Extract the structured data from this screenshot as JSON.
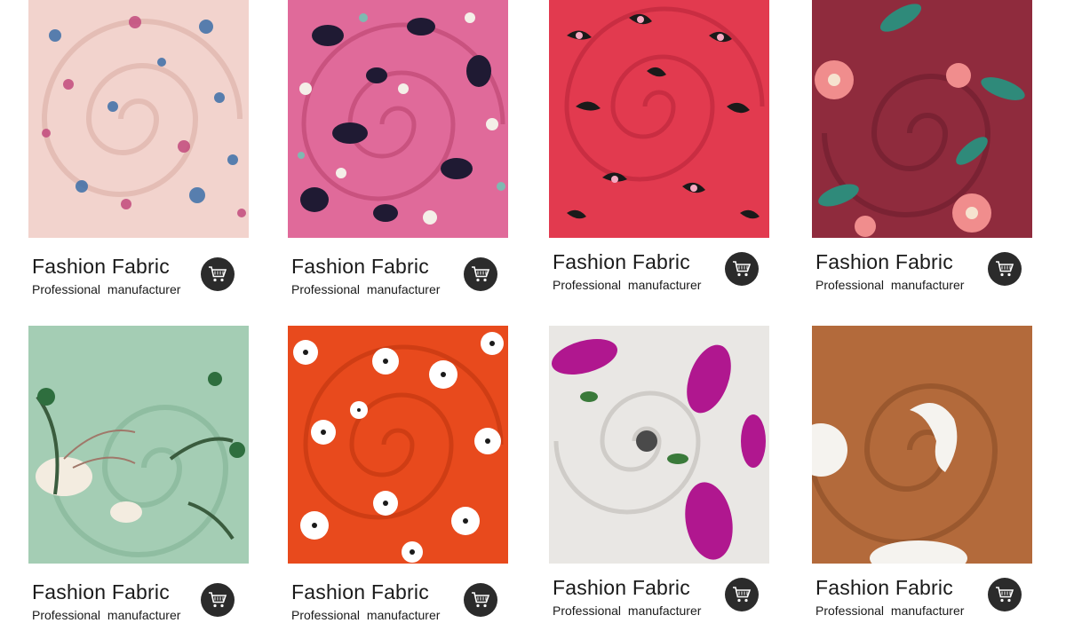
{
  "products": [
    {
      "title": "Fashion Fabric",
      "subtitle": "Professional  manufacturer",
      "swatch": "pink-floral-bullet-knit",
      "colors": {
        "base": "#f2d3cd",
        "accent1": "#3c6fa8",
        "accent2": "#c24a7c"
      }
    },
    {
      "title": "Fashion Fabric",
      "subtitle": "Professional  manufacturer",
      "swatch": "pink-navy-floral",
      "colors": {
        "base": "#e06a9a",
        "accent1": "#1f1a33",
        "accent2": "#f4efe8"
      }
    },
    {
      "title": "Fashion Fabric",
      "subtitle": "Professional  manufacturer",
      "swatch": "red-leopard",
      "colors": {
        "base": "#e23a4f",
        "accent1": "#1a1a1a",
        "accent2": "#f6a9c2"
      }
    },
    {
      "title": "Fashion Fabric",
      "subtitle": "Professional  manufacturer",
      "swatch": "burgundy-floral",
      "colors": {
        "base": "#8f2b3d",
        "accent1": "#2f8a7a",
        "accent2": "#f08d8d"
      }
    },
    {
      "title": "Fashion Fabric",
      "subtitle": "Professional  manufacturer",
      "swatch": "sage-tropical",
      "colors": {
        "base": "#a4cdb4",
        "accent1": "#3a5c3e",
        "accent2": "#f3ece0"
      }
    },
    {
      "title": "Fashion Fabric",
      "subtitle": "Professional  manufacturer",
      "swatch": "orange-daisy",
      "colors": {
        "base": "#e84a1d",
        "accent1": "#ffffff",
        "accent2": "#1a1a1a"
      }
    },
    {
      "title": "Fashion Fabric",
      "subtitle": "Professional  manufacturer",
      "swatch": "white-magenta-floral",
      "colors": {
        "base": "#e9e7e4",
        "accent1": "#b0178f",
        "accent2": "#3a7a3a"
      }
    },
    {
      "title": "Fashion Fabric",
      "subtitle": "Professional  manufacturer",
      "swatch": "rust-dot",
      "colors": {
        "base": "#b36a3b",
        "accent1": "#f5f3ef",
        "accent2": "#8a4c27"
      }
    }
  ],
  "icons": {
    "cart": "shopping-cart-icon"
  }
}
